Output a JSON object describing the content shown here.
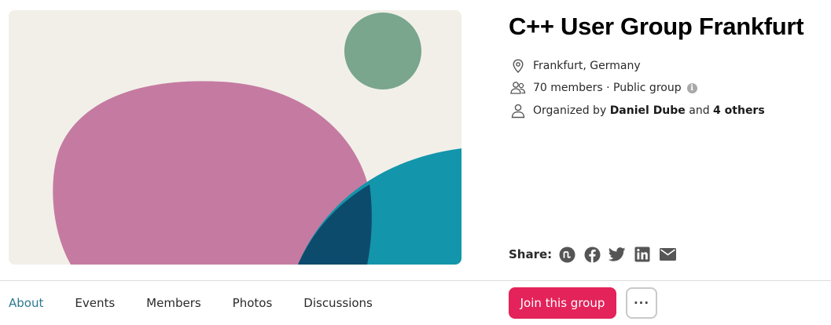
{
  "group": {
    "title": "C++ User Group Frankfurt",
    "location": "Frankfurt, Germany",
    "members_text": "70 members · Public group",
    "organized_prefix": "Organized by",
    "organizer_name": "Daniel Dube",
    "organized_and": "and",
    "organizer_others": "4 others"
  },
  "share": {
    "label": "Share:",
    "icons": [
      "meetup-icon",
      "facebook-icon",
      "twitter-icon",
      "linkedin-icon",
      "email-icon"
    ]
  },
  "tabs": [
    "About",
    "Events",
    "Members",
    "Photos",
    "Discussions"
  ],
  "actions": {
    "join_label": "Join this group",
    "more_label": "···"
  },
  "colors": {
    "accent": "#e32359",
    "active_tab": "#2d7a8e",
    "hero_bg": "#f2efe9",
    "hero_pink": "#c57ba1",
    "hero_green": "#79a68c",
    "hero_teal": "#1395ab",
    "hero_navy": "#0d4b6d"
  }
}
